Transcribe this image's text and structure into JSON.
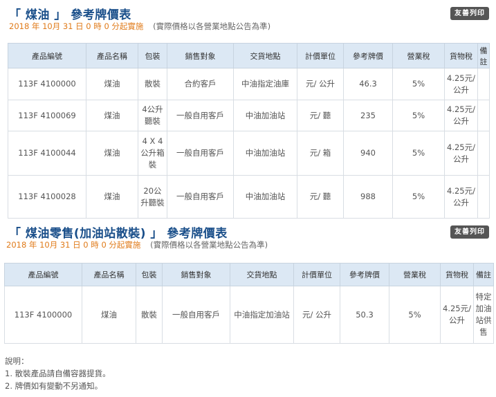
{
  "section1": {
    "title": "「 煤油 」 參考牌價表",
    "date_text": "2018 年 10月 31 日 0 時 0 分起實施",
    "note_text": "(實際價格以各營業地點公告為準)",
    "print_label": "友善列印",
    "headers": [
      "產品編號",
      "產品名稱",
      "包裝",
      "銷售對象",
      "交貨地點",
      "計價單位",
      "參考牌價",
      "營業稅",
      "貨物稅",
      "備註"
    ],
    "rows": [
      [
        "113F 4100000",
        "煤油",
        "散裝",
        "合約客戶",
        "中油指定油庫",
        "元/ 公升",
        "46.3",
        "5%",
        "4.25元/公升",
        ""
      ],
      [
        "113F 4100069",
        "煤油",
        "4公升聽裝",
        "一般自用客戶",
        "中油加油站",
        "元/ 聽",
        "235",
        "5%",
        "4.25元/公升",
        ""
      ],
      [
        "113F 4100044",
        "煤油",
        "4 X 4 公升箱裝",
        "一般自用客戶",
        "中油加油站",
        "元/ 箱",
        "940",
        "5%",
        "4.25元/公升",
        ""
      ],
      [
        "113F 4100028",
        "煤油",
        "20公升聽裝",
        "一般自用客戶",
        "中油加油站",
        "元/ 聽",
        "988",
        "5%",
        "4.25元/公升",
        ""
      ]
    ]
  },
  "section2": {
    "title": "「 煤油零售(加油站散裝) 」 參考牌價表",
    "date_text": "2018 年 10月 31 日 0 時 0 分起實施",
    "note_text": "(實際價格以各營業地點公告為準)",
    "print_label": "友善列印",
    "headers": [
      "產品編號",
      "產品名稱",
      "包裝",
      "銷售對象",
      "交貨地點",
      "計價單位",
      "參考牌價",
      "營業稅",
      "貨物稅",
      "備註"
    ],
    "rows": [
      [
        "113F 4100000",
        "煤油",
        "散裝",
        "一般自用客戶",
        "中油指定加油站",
        "元/ 公升",
        "50.3",
        "5%",
        "4.25元/公升",
        "特定加油站供售"
      ]
    ]
  },
  "notes": {
    "heading": "說明：",
    "items": [
      "1. 散裝產品請自備容器提貨。",
      "2. 牌價如有變動不另通知。"
    ]
  }
}
